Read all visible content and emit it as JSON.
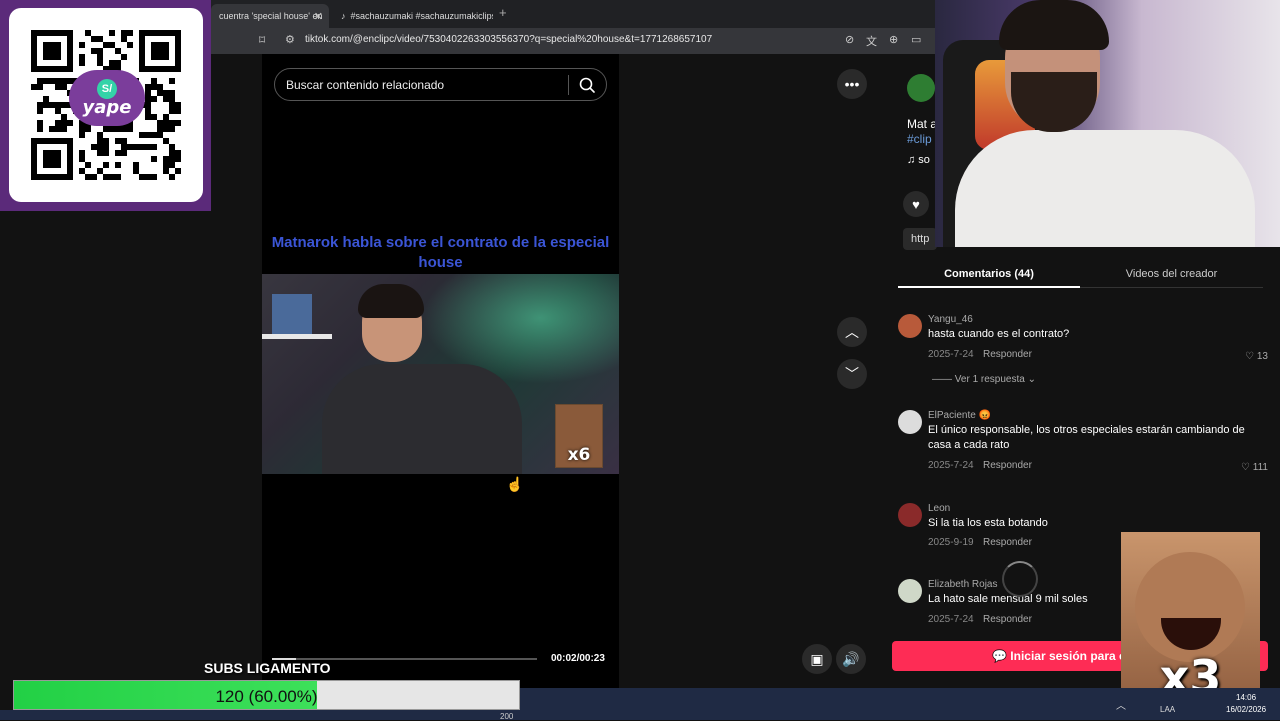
{
  "overlay": {
    "qr_brand": "yape",
    "qr_brand_mark": "S/",
    "subs_goal": {
      "label": "SUBS LIGAMENTO",
      "value_text": "120 (60.00%)",
      "progress_fraction": 0.6
    },
    "meme_badge_small": "x6",
    "meme_badge_large": "x3"
  },
  "browser": {
    "tabs": [
      {
        "title": "cuentra 'special house' en"
      },
      {
        "title": "#sachauzumaki #sachauzumakiclips"
      }
    ],
    "url": "tiktok.com/@enclipc/video/7530402263303556370?q=special%20house&t=1771268657107"
  },
  "page": {
    "search": {
      "placeholder": "Buscar contenido relacionado"
    },
    "video": {
      "caption": "Matnarok habla sobre el contrato de la especial house",
      "time": "00:02/00:23",
      "progress_fraction": 0.09
    },
    "description": {
      "text": "Mat a",
      "hashtag": "#clip",
      "music": "♫ so"
    },
    "link_text": "http",
    "tabs": {
      "comments": "Comentarios (44)",
      "creator_videos": "Videos del creador"
    },
    "comments": [
      {
        "user": "Yangu_46",
        "text": "hasta cuando es el contrato?",
        "date": "2025-7-24",
        "reply": "Responder",
        "likes": "13",
        "avatar_color": "#b85a3a"
      },
      {
        "user": "ElPaciente 😡",
        "text": "El único responsable, los otros especiales estarán cambiando de casa a cada rato",
        "date": "2025-7-24",
        "reply": "Responder",
        "likes": "111",
        "avatar_color": "#dcdcdc"
      },
      {
        "user": "Leon",
        "text": "Si la tia los esta botando",
        "date": "2025-9-19",
        "reply": "Responder",
        "likes": "",
        "avatar_color": "#8a2a2a"
      },
      {
        "user": "Elizabeth Rojas",
        "text": "La hato sale mensual 9 mil soles",
        "date": "2025-7-24",
        "reply": "Responder",
        "likes": "",
        "avatar_color": "#cfd8c8"
      }
    ],
    "replies_toggle": "Ver 1 respuesta",
    "login_button": "Iniciar sesión para c"
  },
  "taskbar": {
    "language": "LAA",
    "time": "14:06",
    "date": "16/02/2026",
    "left_number": "200"
  },
  "colors": {
    "accent": "#fe2c55",
    "subs_fill": "#22d045",
    "qr_panel": "#5b2a7a"
  }
}
